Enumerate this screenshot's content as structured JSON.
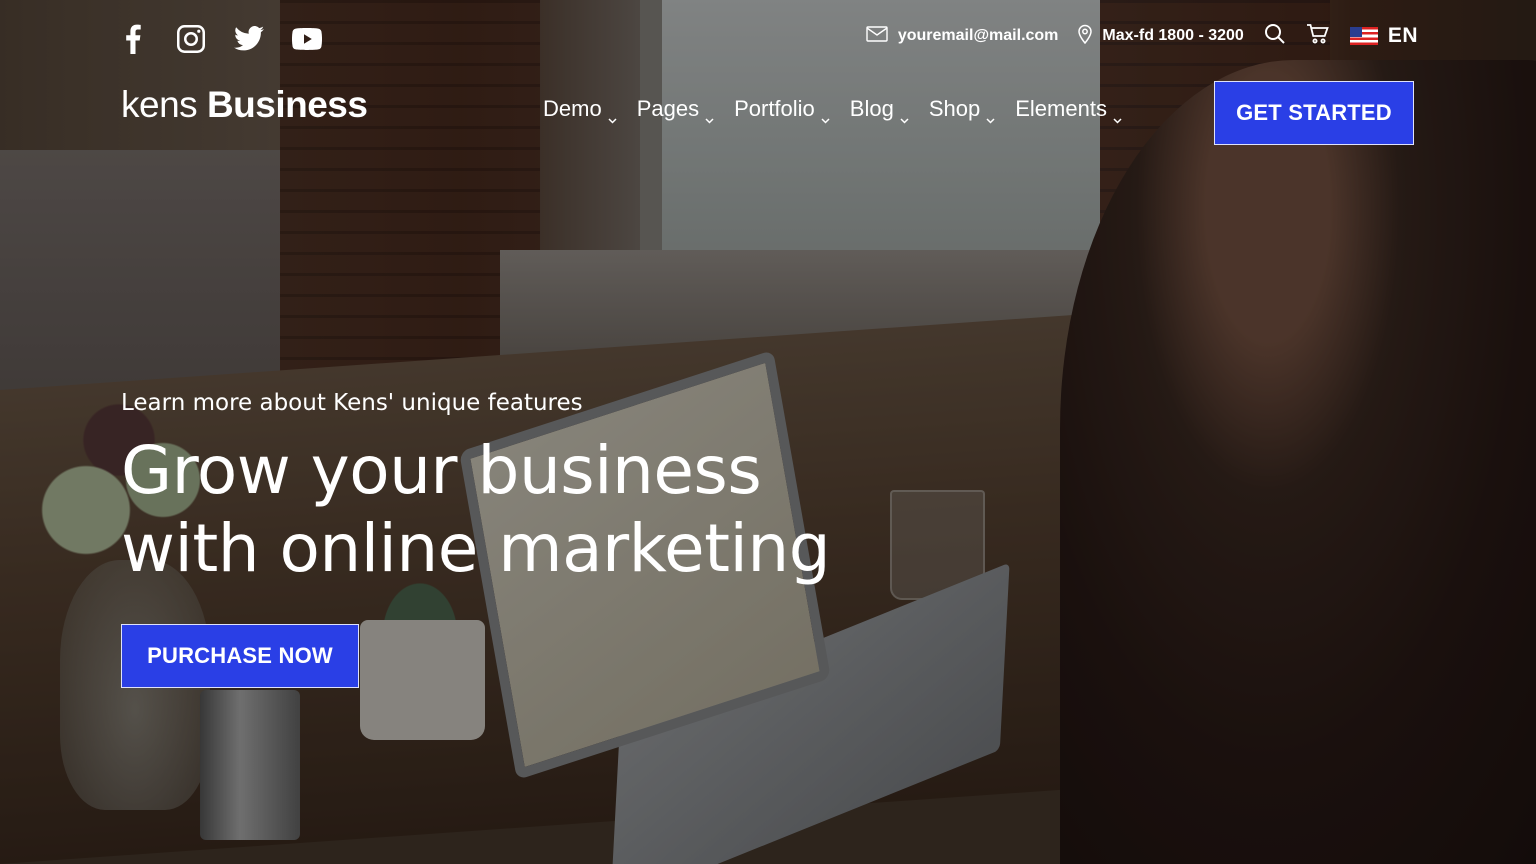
{
  "social": {
    "icons": [
      "facebook-icon",
      "instagram-icon",
      "twitter-icon",
      "youtube-icon"
    ]
  },
  "topbar": {
    "email": "youremail@mail.com",
    "phone": "Max-fd 1800 - 3200",
    "language": "EN",
    "icons": [
      "envelope-icon",
      "map-pin-icon",
      "search-icon",
      "cart-icon",
      "us-flag-icon"
    ]
  },
  "logo": {
    "light": "kens",
    "bold": "Business"
  },
  "nav": {
    "items": [
      {
        "label": "Demo"
      },
      {
        "label": "Pages"
      },
      {
        "label": "Portfolio"
      },
      {
        "label": "Blog"
      },
      {
        "label": "Shop"
      },
      {
        "label": "Elements"
      }
    ],
    "cta": "GET STARTED"
  },
  "hero": {
    "subtitle": "Learn more about Kens' unique features",
    "title_line1": "Grow your business",
    "title_line2": "with online marketing",
    "button": "PURCHASE NOW"
  },
  "colors": {
    "accent": "#2a3fe6",
    "text": "#ffffff"
  }
}
